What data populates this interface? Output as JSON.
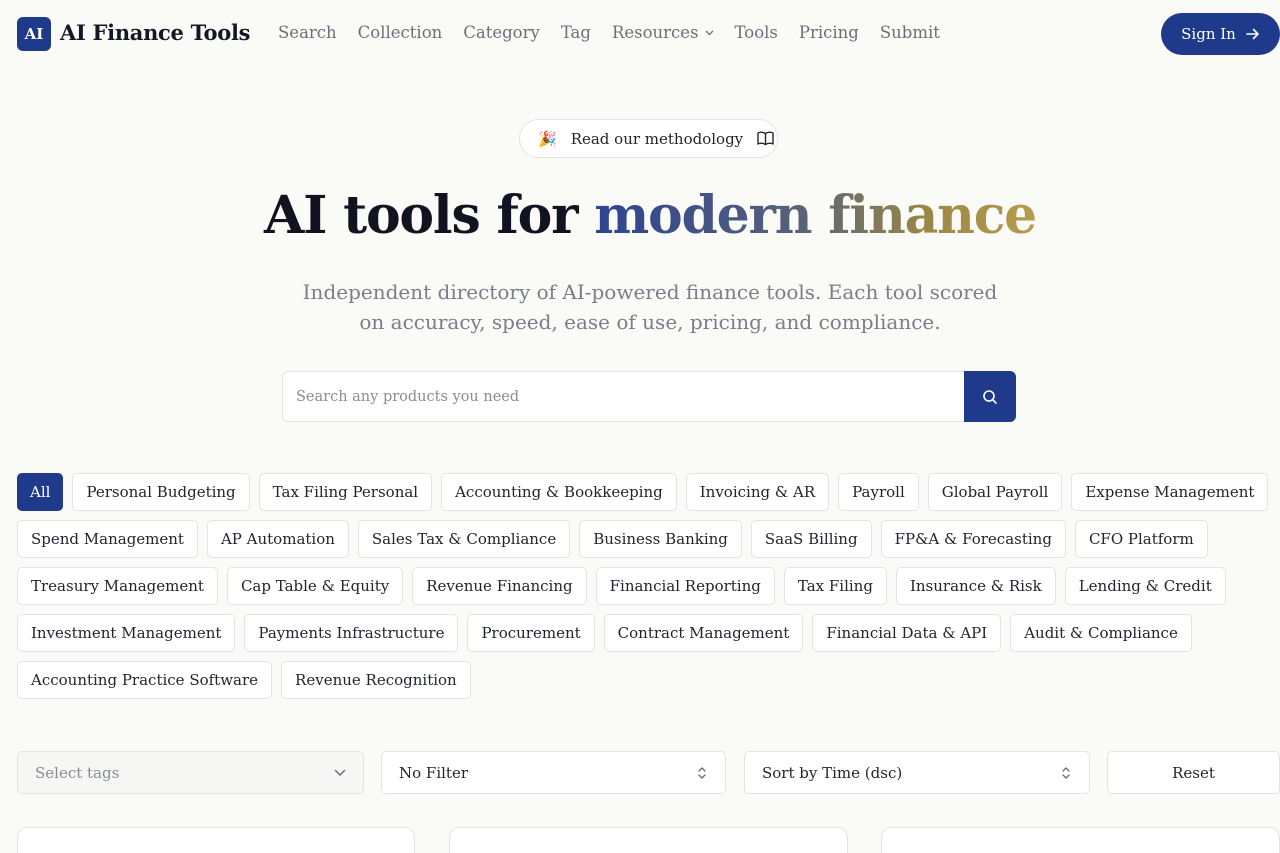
{
  "brand": {
    "logo_badge": "AI",
    "name": "AI Finance Tools"
  },
  "nav": {
    "items": [
      {
        "label": "Search"
      },
      {
        "label": "Collection"
      },
      {
        "label": "Category"
      },
      {
        "label": "Tag"
      },
      {
        "label": "Resources",
        "dropdown": true
      },
      {
        "label": "Tools"
      },
      {
        "label": "Pricing"
      },
      {
        "label": "Submit"
      }
    ],
    "signin_label": "Sign In"
  },
  "hero": {
    "pill_emoji": "🎉",
    "pill_label": "Read our methodology",
    "title_plain": "AI tools for ",
    "title_accent": "modern finance",
    "subtitle": "Independent directory of AI-powered finance tools. Each tool scored on accuracy, speed, ease of use, pricing, and compliance."
  },
  "search": {
    "placeholder": "Search any products you need"
  },
  "categories": {
    "rows": [
      [
        "All",
        "Personal Budgeting",
        "Tax Filing Personal",
        "Accounting & Bookkeeping",
        "Invoicing & AR",
        "Payroll",
        "Global Payroll",
        "Expense Management"
      ],
      [
        "Spend Management",
        "AP Automation",
        "Sales Tax & Compliance",
        "Business Banking",
        "SaaS Billing",
        "FP&A & Forecasting",
        "CFO Platform"
      ],
      [
        "Treasury Management",
        "Cap Table & Equity",
        "Revenue Financing",
        "Financial Reporting",
        "Tax Filing",
        "Insurance & Risk",
        "Lending & Credit"
      ],
      [
        "Investment Management",
        "Payments Infrastructure",
        "Procurement",
        "Contract Management",
        "Financial Data & API",
        "Audit & Compliance"
      ],
      [
        "Accounting Practice Software",
        "Revenue Recognition"
      ]
    ],
    "active": "All"
  },
  "filters": {
    "tags_placeholder": "Select tags",
    "filter_value": "No Filter",
    "sort_value": "Sort by Time (dsc)",
    "reset_label": "Reset"
  },
  "colors": {
    "primary": "#1f3a8a",
    "background": "#fafaf7",
    "border": "#e2e3e6"
  }
}
